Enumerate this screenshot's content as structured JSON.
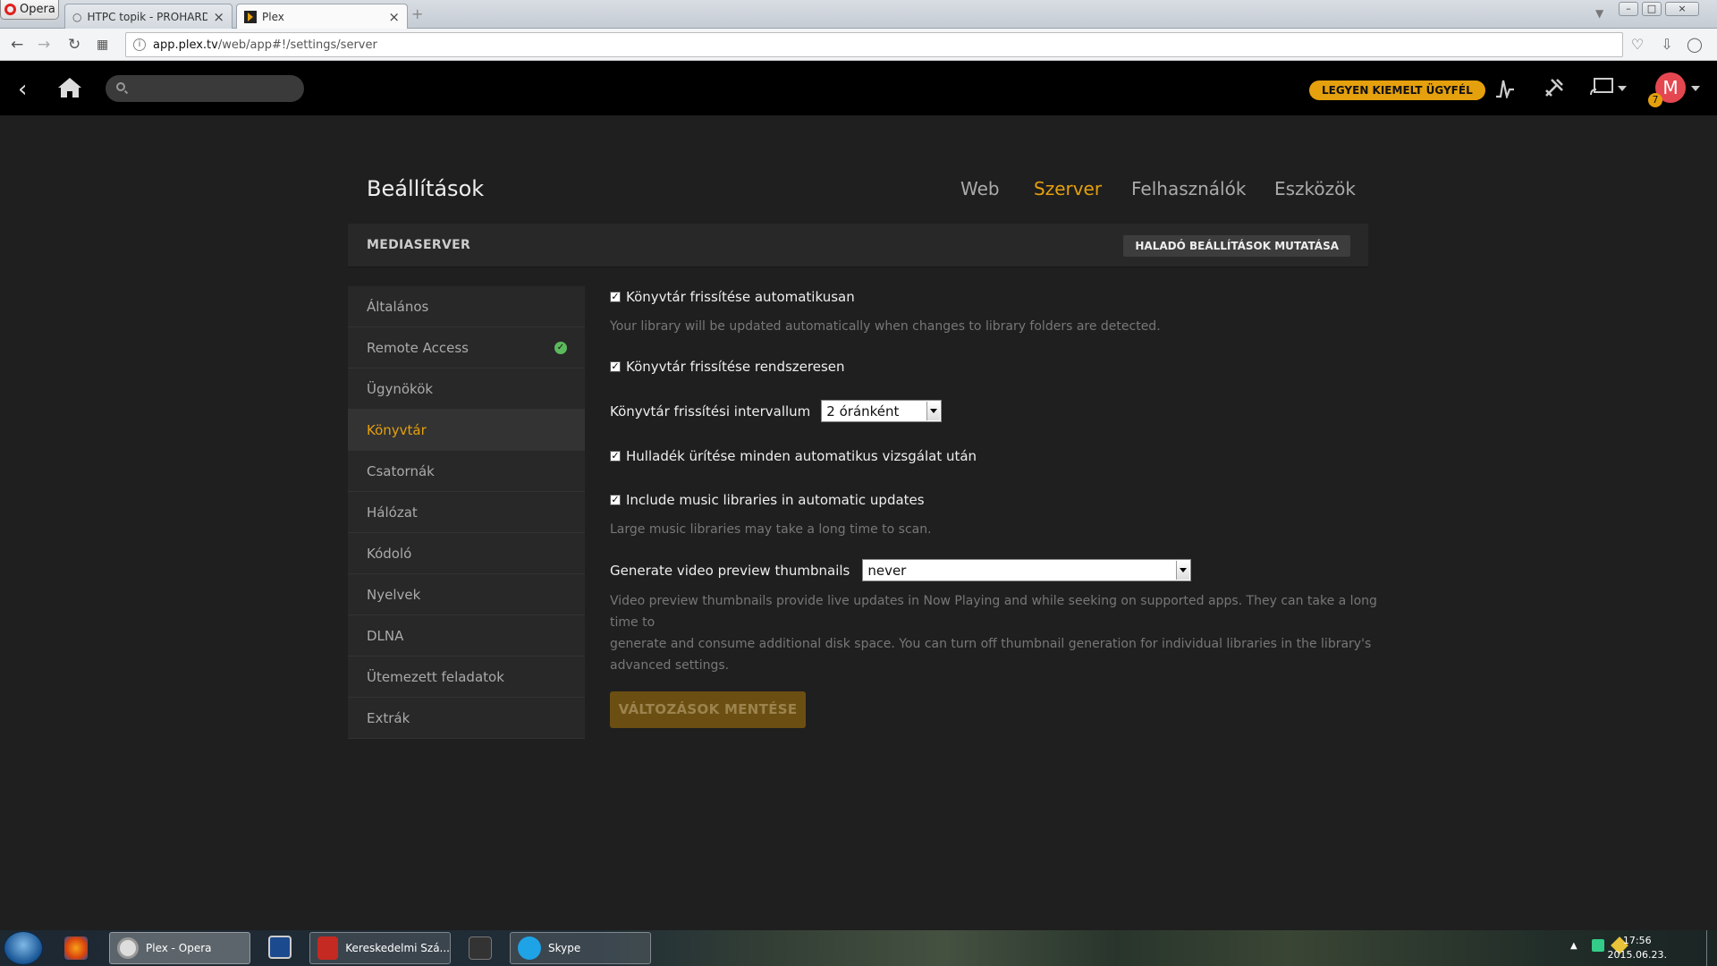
{
  "browser": {
    "menu_label": "Opera",
    "tabs": [
      {
        "title": "HTPC topik - PROHARDVE"
      },
      {
        "title": "Plex"
      }
    ],
    "url_host": "app.plex.tv",
    "url_path": "/web/app#!/settings/server"
  },
  "plex_bar": {
    "search_placeholder": "",
    "premium_label": "LEGYEN KIEMELT ÜGYFÉL",
    "avatar_letter": "M",
    "notification_count": "7",
    "accent_color": "#e5a00d"
  },
  "settings": {
    "title": "Beállítások",
    "tabs": [
      {
        "label": "Web"
      },
      {
        "label": "Szerver"
      },
      {
        "label": "Felhasználók"
      },
      {
        "label": "Eszközök"
      }
    ],
    "active_tab": "Szerver",
    "section_title": "MEDIASERVER",
    "advanced_button": "HALADÓ BEÁLLÍTÁSOK MUTATÁSA",
    "sidebar": [
      {
        "label": "Általános"
      },
      {
        "label": "Remote Access"
      },
      {
        "label": "Ügynökök"
      },
      {
        "label": "Könyvtár"
      },
      {
        "label": "Csatornák"
      },
      {
        "label": "Hálózat"
      },
      {
        "label": "Kódoló"
      },
      {
        "label": "Nyelvek"
      },
      {
        "label": "DLNA"
      },
      {
        "label": "Ütemezett feladatok"
      },
      {
        "label": "Extrák"
      }
    ],
    "active_sidebar": "Könyvtár",
    "options": {
      "auto_update": {
        "label": "Könyvtár frissítése automatikusan",
        "checked": true,
        "help": "Your library will be updated automatically when changes to library folders are detected."
      },
      "periodic_update": {
        "label": "Könyvtár frissítése rendszeresen",
        "checked": true
      },
      "interval": {
        "label": "Könyvtár frissítési intervallum",
        "value": "2 óránként"
      },
      "empty_trash": {
        "label": "Hulladék ürítése minden automatikus vizsgálat után",
        "checked": true
      },
      "music_libraries": {
        "label": "Include music libraries in automatic updates",
        "checked": true,
        "help": "Large music libraries may take a long time to scan."
      },
      "thumbnails": {
        "label": "Generate video preview thumbnails",
        "value": "never",
        "help_line1": "Video preview thumbnails provide live updates in Now Playing and while seeking on supported apps. They can take a long time to",
        "help_line2": "generate and consume additional disk space. You can turn off thumbnail generation for individual libraries in the library's",
        "help_line3": "advanced settings."
      }
    },
    "save_button": "VÁLTOZÁSOK MENTÉSE"
  },
  "taskbar": {
    "items": [
      {
        "label": "Plex - Opera"
      },
      {
        "label": "Kereskedelmi Szá..."
      },
      {
        "label": "Skype"
      }
    ],
    "time": "17:56",
    "date": "2015.06.23."
  }
}
